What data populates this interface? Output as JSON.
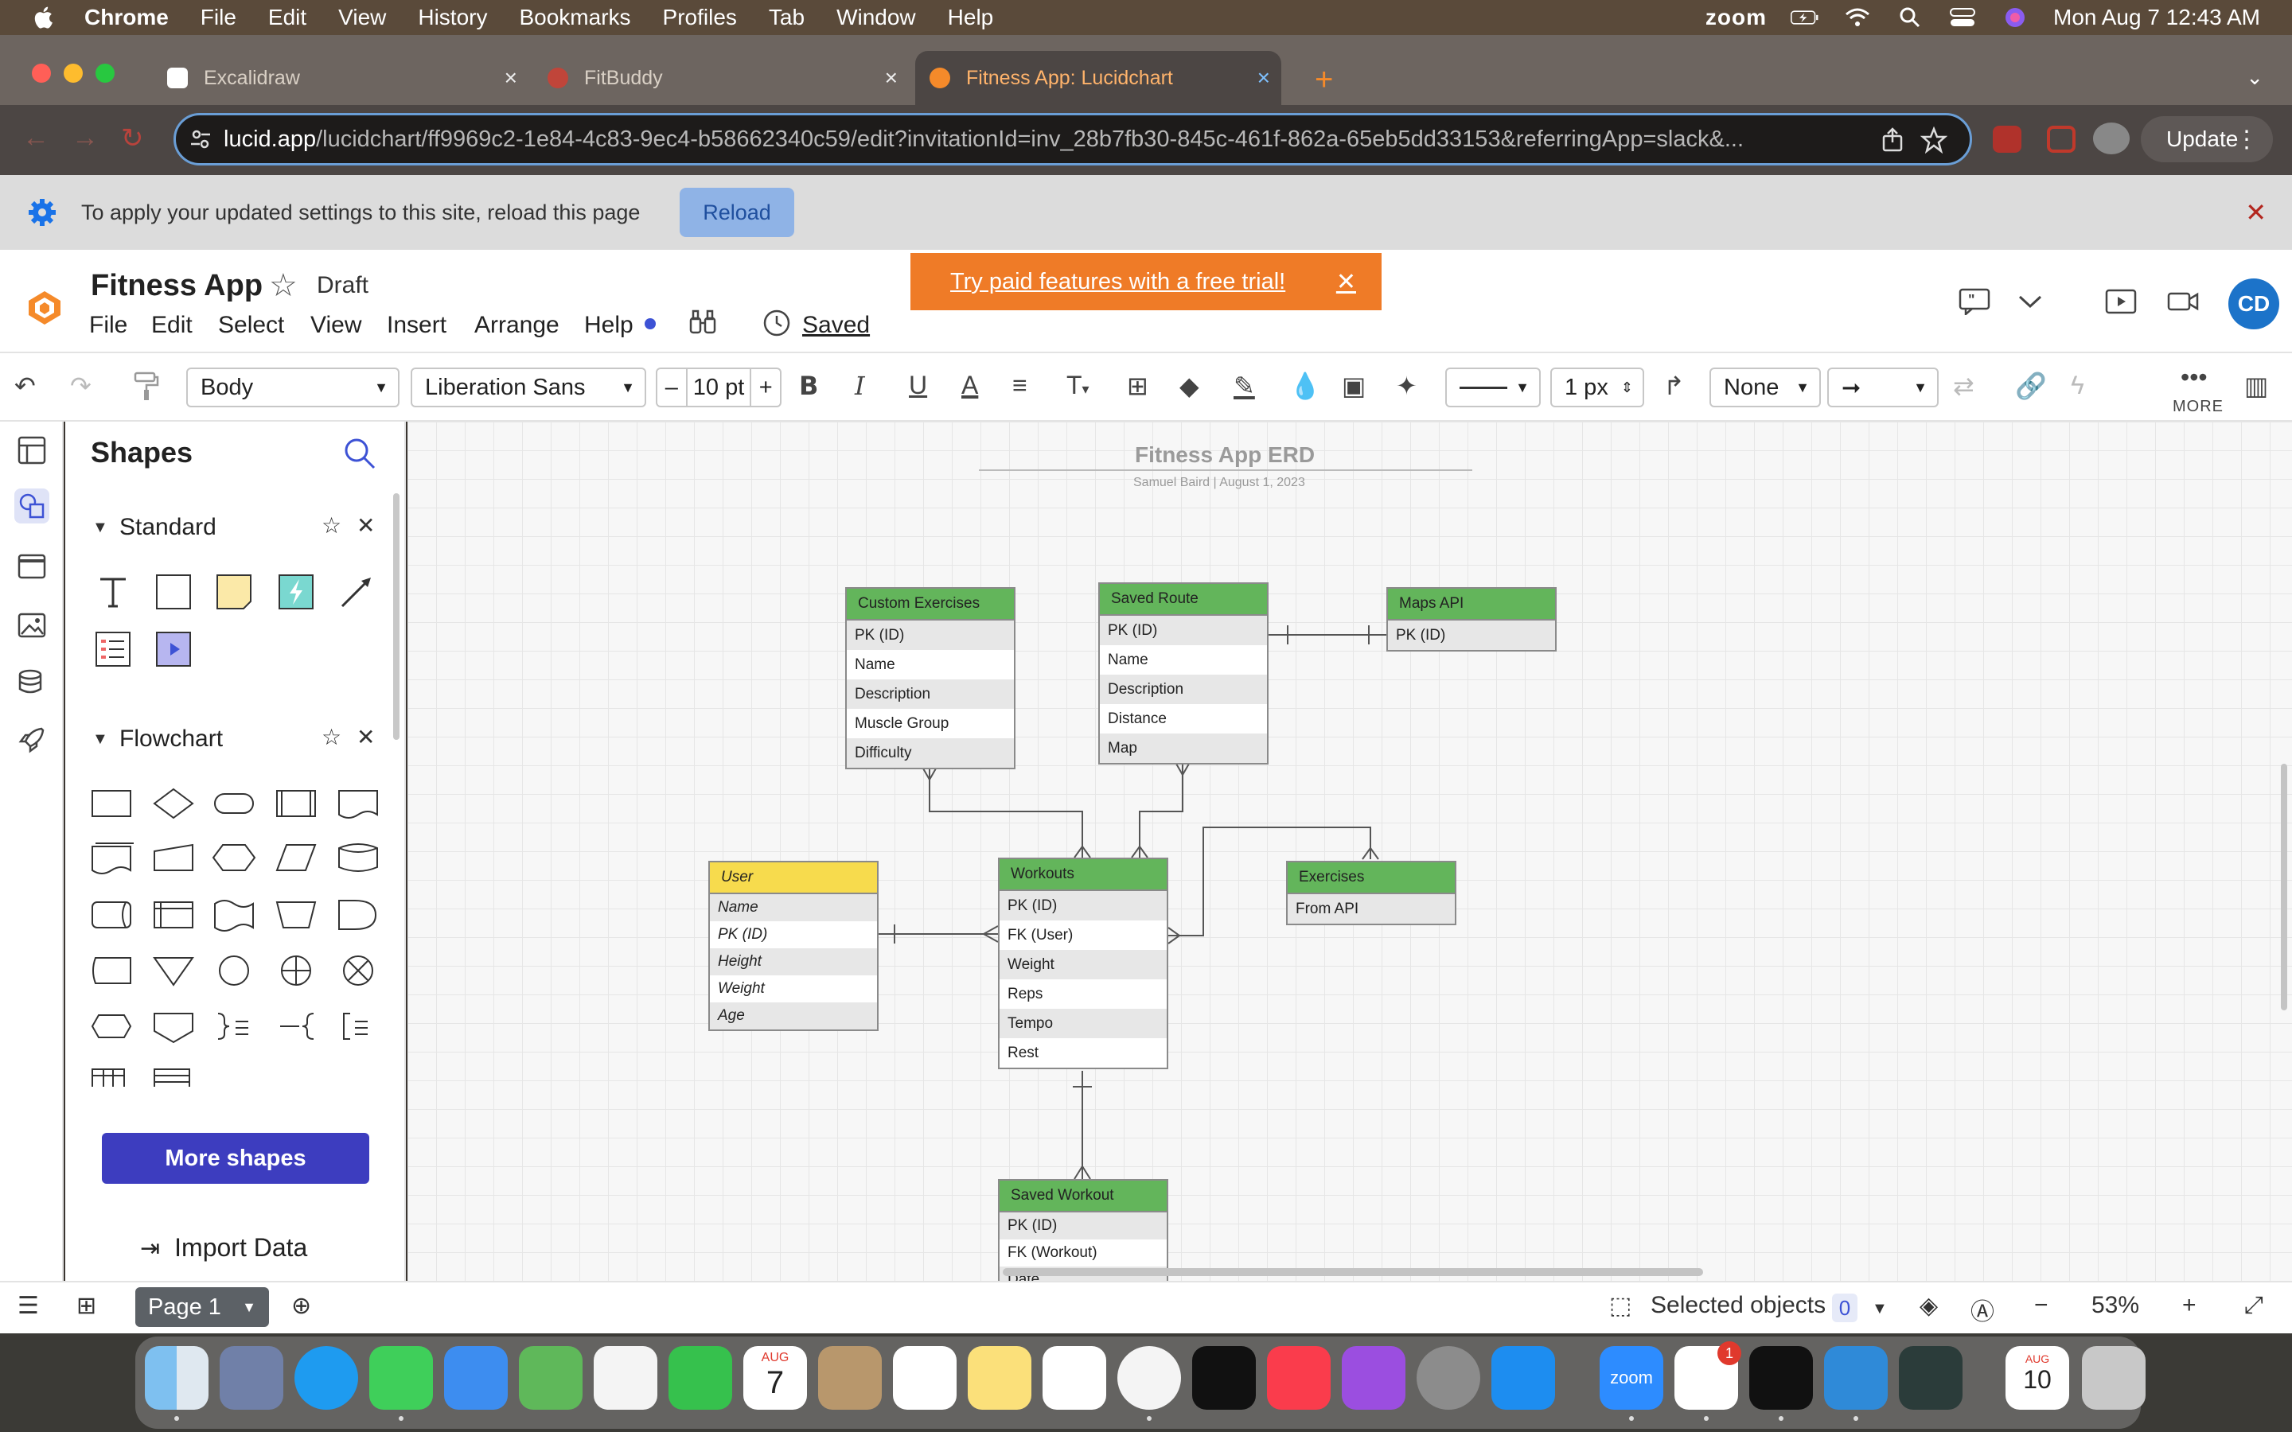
{
  "menubar": {
    "app": "Chrome",
    "items": [
      "File",
      "Edit",
      "View",
      "History",
      "Bookmarks",
      "Profiles",
      "Tab",
      "Window",
      "Help"
    ],
    "zoom": "zoom",
    "datetime": "Mon Aug 7  12:43 AM"
  },
  "browser": {
    "tabs": [
      {
        "label": "Excalidraw"
      },
      {
        "label": "FitBuddy"
      },
      {
        "label": "Fitness App: Lucidchart"
      }
    ],
    "url_host": "lucid.app",
    "url_rest": "/lucidchart/ff9969c2-1e84-4c83-9ec4-b58662340c59/edit?invitationId=inv_28b7fb30-845c-461f-862a-65eb5dd33153&referringApp=slack&...",
    "update_label": "Update"
  },
  "infobar": {
    "message": "To apply your updated settings to this site, reload this page",
    "reload_label": "Reload"
  },
  "lucid": {
    "doc_title": "Fitness App",
    "status": "Draft",
    "menu": [
      "File",
      "Edit",
      "Select",
      "View",
      "Insert",
      "Arrange",
      "Help"
    ],
    "saved_label": "Saved",
    "trial_label": "Try paid features with a free trial!",
    "avatar": "CD"
  },
  "toolbar": {
    "style": "Body",
    "font": "Liberation Sans",
    "font_size": "10 pt",
    "minus": "–",
    "plus": "+",
    "line_width": "1 px",
    "arrow_start": "None",
    "more_label": "MORE"
  },
  "panel": {
    "title": "Shapes",
    "standard": "Standard",
    "flowchart": "Flowchart",
    "more_shapes": "More shapes",
    "import_data": "Import Data"
  },
  "canvas": {
    "title": "Fitness App ERD",
    "subtitle": "Samuel Baird  |  August 1, 2023",
    "entities": {
      "custom": {
        "name": "Custom Exercises",
        "rows": [
          "PK (ID)",
          "Name",
          "Description",
          "Muscle Group",
          "Difficulty"
        ]
      },
      "route": {
        "name": "Saved Route",
        "rows": [
          "PK (ID)",
          "Name",
          "Description",
          "Distance",
          "Map"
        ]
      },
      "maps": {
        "name": "Maps API",
        "rows": [
          "PK (ID)"
        ]
      },
      "user": {
        "name": "User",
        "rows": [
          "Name",
          "PK (ID)",
          "Height",
          "Weight",
          "Age"
        ]
      },
      "workouts": {
        "name": "Workouts",
        "rows": [
          "PK (ID)",
          "FK (User)",
          "Weight",
          "Reps",
          "Tempo",
          "Rest"
        ]
      },
      "exercises": {
        "name": "Exercises",
        "rows": [
          "From API"
        ]
      },
      "savedworkout": {
        "name": "Saved Workout",
        "rows": [
          "PK (ID)",
          "FK (Workout)",
          "Date"
        ]
      }
    }
  },
  "bottombar": {
    "page_label": "Page 1",
    "selected_label": "Selected objects",
    "selected_count": "0",
    "zoom_level": "53%"
  },
  "dock": {
    "calendar_month": "AUG",
    "calendar_day": "7",
    "calendar2_month": "AUG",
    "calendar2_day": "10",
    "slack_badge": "1",
    "zoom_label": "zoom"
  }
}
